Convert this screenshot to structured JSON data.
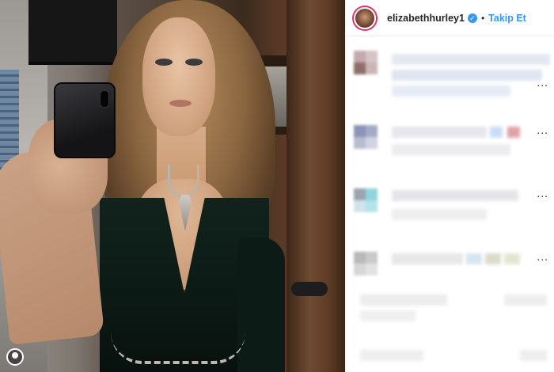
{
  "post": {
    "username": "elizabethhurley1",
    "verified_icon": "verified-badge-icon",
    "separator": "•",
    "follow_label": "Takip Et",
    "more_label": "..."
  },
  "colors": {
    "accent": "#3897f0",
    "avatar_ring": "#e1306c",
    "text": "#262626"
  },
  "photo": {
    "watermark_icon": "instagram-logo-icon"
  }
}
